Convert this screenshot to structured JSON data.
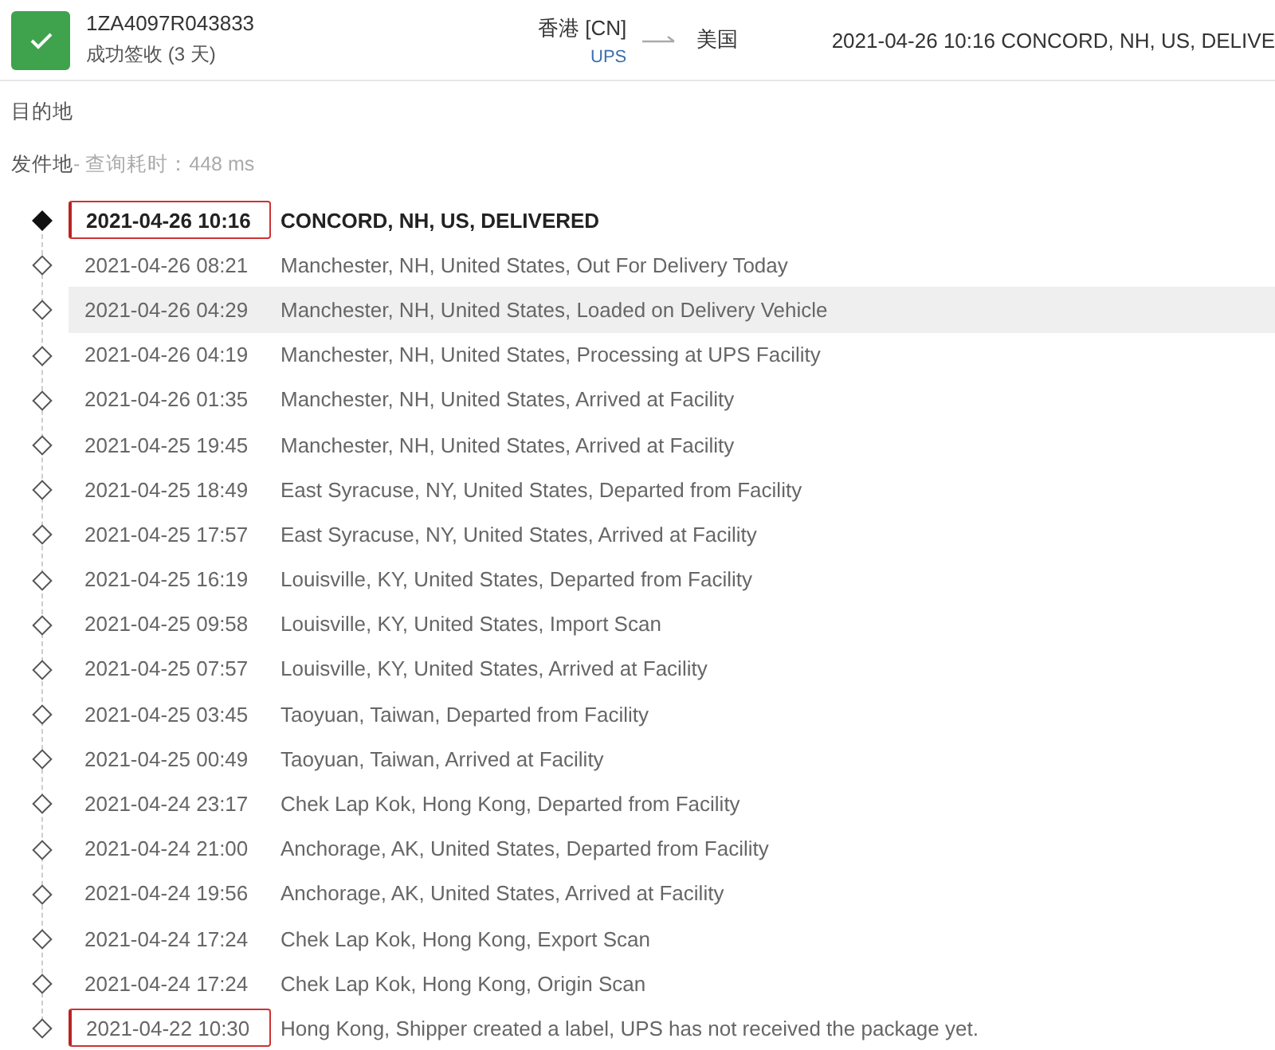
{
  "header": {
    "tracking_number": "1ZA4097R043833",
    "status": "成功签收 (3 天)",
    "origin": "香港 [CN]",
    "carrier": "UPS",
    "destination": "美国",
    "latest": "2021-04-26 10:16  CONCORD, NH, US, DELIVE"
  },
  "destination_label": "目的地",
  "origin_label": "发件地",
  "query_time": " - 查询耗时：448 ms",
  "events": [
    {
      "time": "2021-04-26 10:16",
      "desc": "CONCORD, NH, US, DELIVERED",
      "latest": true,
      "boxed": true,
      "highlighted": false
    },
    {
      "time": "2021-04-26 08:21",
      "desc": "Manchester, NH, United States, Out For Delivery Today",
      "latest": false,
      "boxed": false,
      "highlighted": false
    },
    {
      "time": "2021-04-26 04:29",
      "desc": "Manchester, NH, United States, Loaded on Delivery Vehicle",
      "latest": false,
      "boxed": false,
      "highlighted": true
    },
    {
      "time": "2021-04-26 04:19",
      "desc": "Manchester, NH, United States, Processing at UPS Facility",
      "latest": false,
      "boxed": false,
      "highlighted": false
    },
    {
      "time": "2021-04-26 01:35",
      "desc": "Manchester, NH, United States, Arrived at Facility",
      "latest": false,
      "boxed": false,
      "highlighted": false
    },
    {
      "time": "2021-04-25 19:45",
      "desc": "Manchester, NH, United States, Arrived at Facility",
      "latest": false,
      "boxed": false,
      "highlighted": false
    },
    {
      "time": "2021-04-25 18:49",
      "desc": "East Syracuse, NY, United States, Departed from Facility",
      "latest": false,
      "boxed": false,
      "highlighted": false
    },
    {
      "time": "2021-04-25 17:57",
      "desc": "East Syracuse, NY, United States, Arrived at Facility",
      "latest": false,
      "boxed": false,
      "highlighted": false
    },
    {
      "time": "2021-04-25 16:19",
      "desc": "Louisville, KY, United States, Departed from Facility",
      "latest": false,
      "boxed": false,
      "highlighted": false
    },
    {
      "time": "2021-04-25 09:58",
      "desc": "Louisville, KY, United States, Import Scan",
      "latest": false,
      "boxed": false,
      "highlighted": false
    },
    {
      "time": "2021-04-25 07:57",
      "desc": "Louisville, KY, United States, Arrived at Facility",
      "latest": false,
      "boxed": false,
      "highlighted": false
    },
    {
      "time": "2021-04-25 03:45",
      "desc": "Taoyuan, Taiwan, Departed from Facility",
      "latest": false,
      "boxed": false,
      "highlighted": false
    },
    {
      "time": "2021-04-25 00:49",
      "desc": "Taoyuan, Taiwan, Arrived at Facility",
      "latest": false,
      "boxed": false,
      "highlighted": false
    },
    {
      "time": "2021-04-24 23:17",
      "desc": "Chek Lap Kok, Hong Kong, Departed from Facility",
      "latest": false,
      "boxed": false,
      "highlighted": false
    },
    {
      "time": "2021-04-24 21:00",
      "desc": "Anchorage, AK, United States, Departed from Facility",
      "latest": false,
      "boxed": false,
      "highlighted": false
    },
    {
      "time": "2021-04-24 19:56",
      "desc": "Anchorage, AK, United States, Arrived at Facility",
      "latest": false,
      "boxed": false,
      "highlighted": false
    },
    {
      "time": "2021-04-24 17:24",
      "desc": "Chek Lap Kok, Hong Kong, Export Scan",
      "latest": false,
      "boxed": false,
      "highlighted": false
    },
    {
      "time": "2021-04-24 17:24",
      "desc": "Chek Lap Kok, Hong Kong, Origin Scan",
      "latest": false,
      "boxed": false,
      "highlighted": false
    },
    {
      "time": "2021-04-22 10:30",
      "desc": "Hong Kong, Shipper created a label, UPS has not received the package yet.",
      "latest": false,
      "boxed": true,
      "highlighted": false
    }
  ]
}
